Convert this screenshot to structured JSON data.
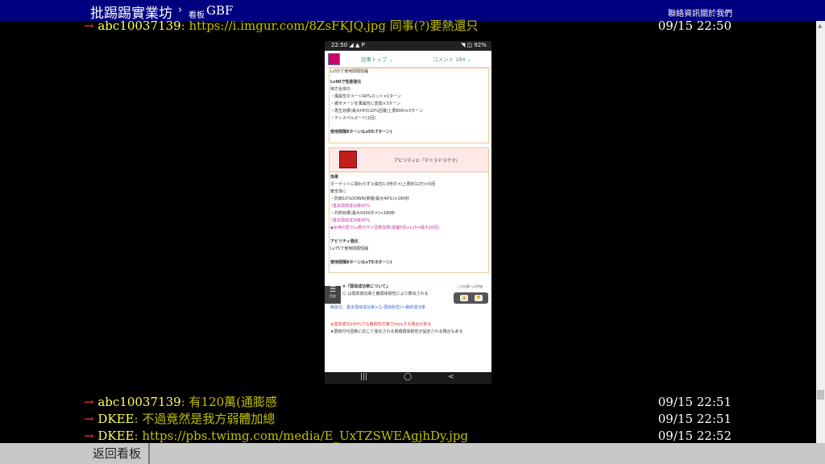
{
  "header": {
    "site_title": "批踢踢實業坊",
    "separator": "›",
    "board_label": "看板",
    "board_name": "GBF",
    "links": [
      "聯絡資訊",
      "關於我們"
    ]
  },
  "pushes": [
    {
      "tag": "→",
      "user": "abc10037139",
      "content": ": https://i.imgur.com/8ZsFKJQ.jpg 同事(?)要熱還只",
      "time": "09/15 22:50"
    },
    {
      "tag": "→",
      "user": "abc10037139",
      "content": ": 有120萬(通膨感",
      "time": "09/15 22:51"
    },
    {
      "tag": "→",
      "user": "DKEE",
      "content": ": 不過竟然是我方弱體加總",
      "time": "09/15 22:51"
    },
    {
      "tag": "→",
      "user": "DKEE",
      "content": ": https://pbs.twimg.com/media/E_UxTZSWEAgjhDy.jpg",
      "time": "09/15 22:52"
    }
  ],
  "phone": {
    "status_time": "22:50",
    "status_icons": "◢ ▲ P",
    "status_right": "◥ ◫ 92%",
    "tab_article": "記事トップ ⌄",
    "tab_comments": "コメント 184 ⌄",
    "lines_top": [
      "Lv55で使用間隔短縮",
      "Lv90で性能強化",
      "味方全体の",
      "・風属性ダメージ40%カット×1ターン",
      "・被ダメージを風属性に変換×3ターン",
      "・再生効果(最大HPの10%回復/上限800)×3ターン",
      "・ディスペルガード(1回)",
      "使用間隔8ターン(Lv55:7ターン)"
    ],
    "ability_title": "アビリティ2:『テトラドラクマ』",
    "lines_mid": [
      "効果",
      "ターゲットに関わらず火属性1.0倍ダメ(上限約12万)×5回",
      "敵全体に",
      "・防御10%DOWN(累積/最大40%)×180秒",
      "└基本弱体成功率90%",
      "・灼熱効果(最大5000ダメ)×180秒",
      "└基本弱体成功率90%",
      "◆女神の怒りLv数分ダメ回数加算(基礎5回+Lv5=最大10回)",
      "アビリティ強化",
      "Lv75で使用間隔短縮",
      "使用間隔8ターン(Lv75:5ターン)"
    ],
    "lines_bottom": [
      "⑥『弱体成功率について』",
      "に は弱体成功率と敵弱体耐性により算出される",
      "簡易式：基本弱体成功率×(1-弱体耐性)＝最終成功率",
      "★基本成功100%でも敵耐性次第でmissする場合がある",
      "★弱体付与回数に応じて強化される累積弱体耐性が設定される場合もある"
    ],
    "menu_label": "目次",
    "vote_label": "この記事への評価",
    "nav": [
      "|||",
      "◯",
      "<"
    ]
  },
  "footer": {
    "back_label": "返回看板"
  }
}
